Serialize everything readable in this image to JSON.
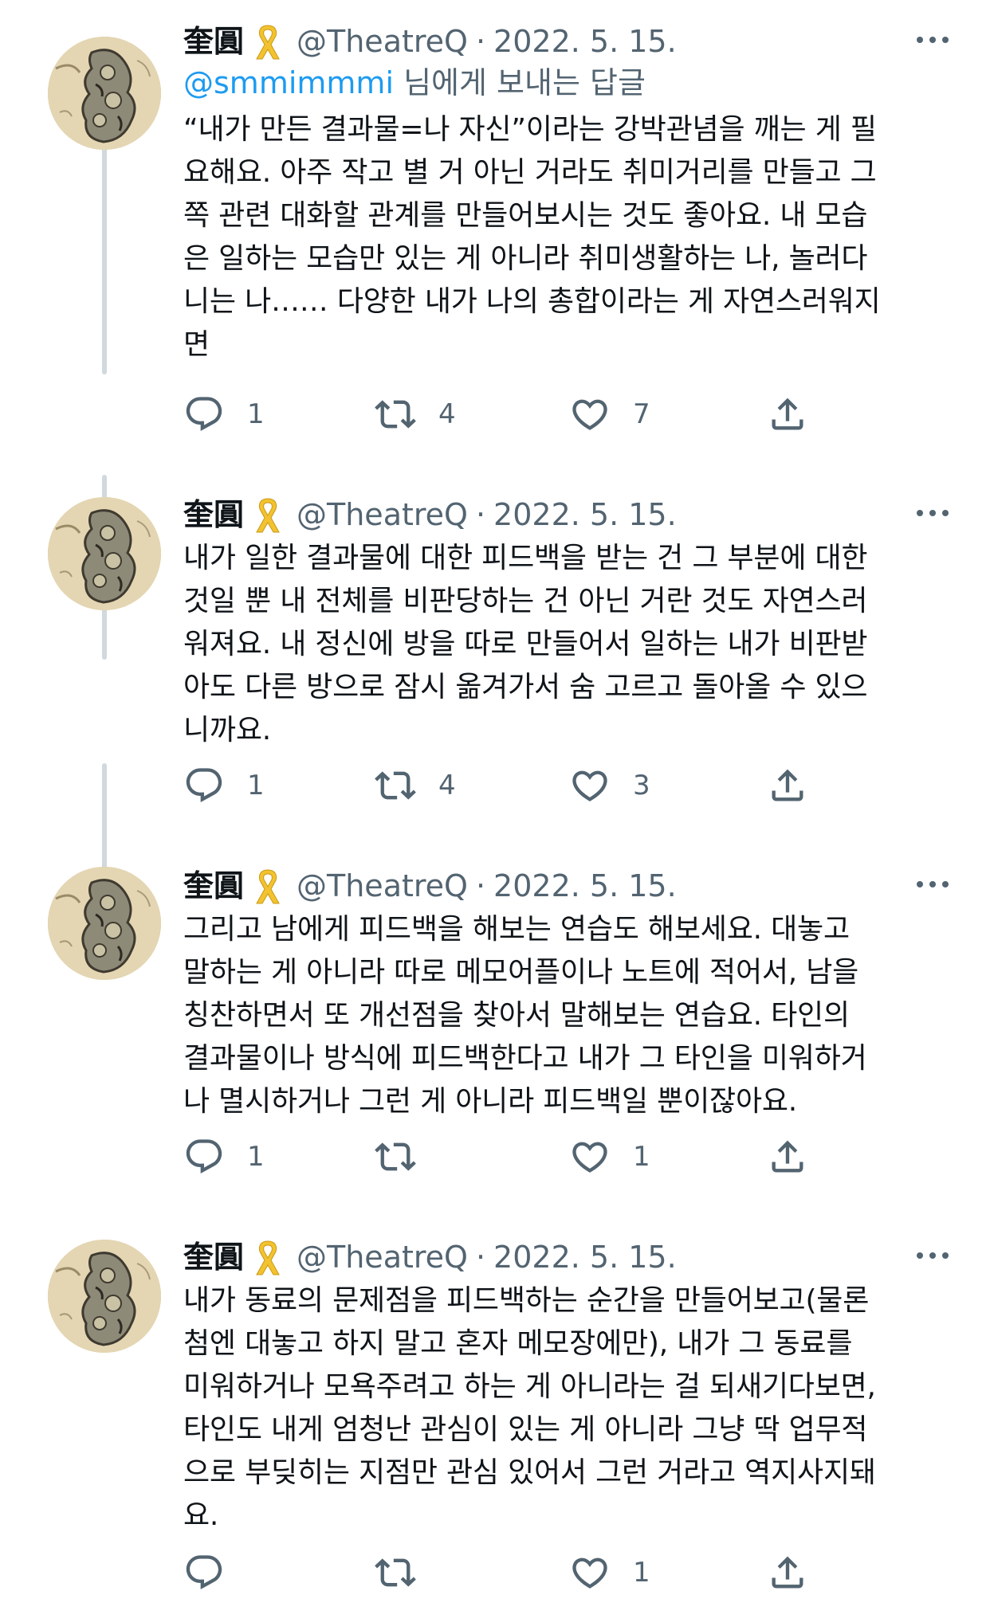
{
  "tweets": [
    {
      "name": "奎圓",
      "handle": "@TheatreQ",
      "separator": "·",
      "date": "2022. 5. 15.",
      "reply_mention": "@smmimmmi",
      "reply_suffix": " 님에게 보내는 답글",
      "lines": [
        "“내가 만든 결과물=나 자신”이라는 강박관념을 깨는 게 필",
        "요해요. 아주 작고 별 거 아닌 거라도 취미거리를 만들고 그",
        "쪽 관련 대화할 관계를 만들어보시는 것도 좋아요. 내 모습",
        "은 일하는 모습만 있는 게 아니라 취미생활하는 나, 놀러다",
        "니는 나…… 다양한 내가 나의 총합이라는 게 자연스러워지",
        "면"
      ],
      "replies": "1",
      "retweets": "4",
      "likes": "7"
    },
    {
      "name": "奎圓",
      "handle": "@TheatreQ",
      "separator": "·",
      "date": "2022. 5. 15.",
      "lines": [
        "내가 일한 결과물에 대한 피드백을 받는 건 그 부분에 대한",
        "것일 뿐 내 전체를 비판당하는 건 아닌 거란 것도 자연스러",
        "워져요. 내 정신에 방을 따로 만들어서 일하는 내가 비판받",
        "아도 다른 방으로 잠시 옮겨가서 숨 고르고 돌아올 수 있으",
        "니까요."
      ],
      "replies": "1",
      "retweets": "4",
      "likes": "3"
    },
    {
      "name": "奎圓",
      "handle": "@TheatreQ",
      "separator": "·",
      "date": "2022. 5. 15.",
      "lines": [
        "그리고 남에게 피드백을 해보는 연습도 해보세요. 대놓고",
        "말하는 게 아니라 따로 메모어플이나 노트에 적어서, 남을",
        "칭찬하면서 또 개선점을 찾아서 말해보는 연습요. 타인의",
        "결과물이나 방식에 피드백한다고 내가 그 타인을 미워하거",
        "나 멸시하거나 그런 게 아니라 피드백일 뿐이잖아요."
      ],
      "replies": "1",
      "retweets": "",
      "likes": "1"
    },
    {
      "name": "奎圓",
      "handle": "@TheatreQ",
      "separator": "·",
      "date": "2022. 5. 15.",
      "lines": [
        "내가 동료의 문제점을 피드백하는 순간을 만들어보고(물론",
        "첨엔 대놓고 하지 말고 혼자 메모장에만), 내가 그 동료를",
        "미워하거나 모욕주려고 하는 게 아니라는 걸 되새기다보면,",
        "타인도 내게 엄청난 관심이 있는 게 아니라 그냥 딱 업무적",
        "으로 부딪히는 지점만 관심 있어서 그런 거라고 역지사지돼",
        "요."
      ],
      "replies": "",
      "retweets": "",
      "likes": "1"
    }
  ],
  "colors": {
    "text": "#0f1419",
    "secondary": "#536471",
    "link": "#1d9bf0",
    "thread_line": "#cfd9de",
    "ribbon": "#f2c230"
  },
  "icons": [
    "more-icon",
    "yellow-ribbon-icon",
    "reply-icon",
    "retweet-icon",
    "like-icon",
    "share-icon"
  ]
}
